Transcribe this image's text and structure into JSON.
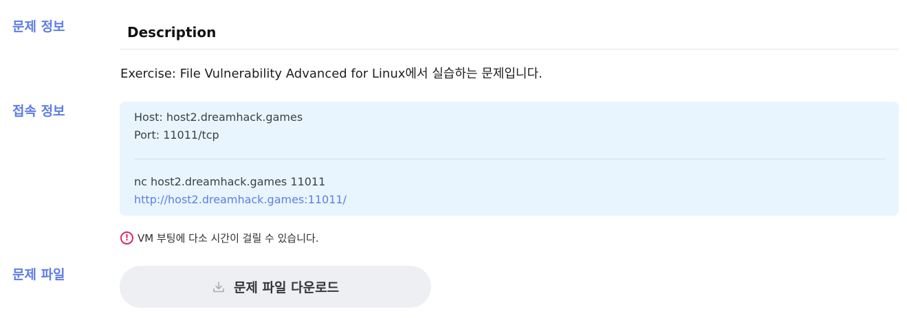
{
  "sections": {
    "problem_info": "문제 정보",
    "connection_info": "접속 정보",
    "problem_file": "문제 파일"
  },
  "description": {
    "title": "Description",
    "text": "Exercise: File Vulnerability Advanced for Linux에서 실습하는 문제입니다."
  },
  "connection": {
    "host": "Host: host2.dreamhack.games",
    "port": "Port: 11011/tcp",
    "nc_command": "nc host2.dreamhack.games 11011",
    "url": "http://host2.dreamhack.games:11011/"
  },
  "notice": {
    "icon": "alert-circle-icon",
    "symbol": "!",
    "text": "VM 부팅에 다소 시간이 걸릴 수 있습니다."
  },
  "download": {
    "icon": "download-icon",
    "label": "문제 파일 다운로드"
  },
  "colors": {
    "accent": "#5c7ce6",
    "connection_bg": "#e9f5fe",
    "warning": "#e0245e",
    "button_bg": "#eeeff2"
  }
}
